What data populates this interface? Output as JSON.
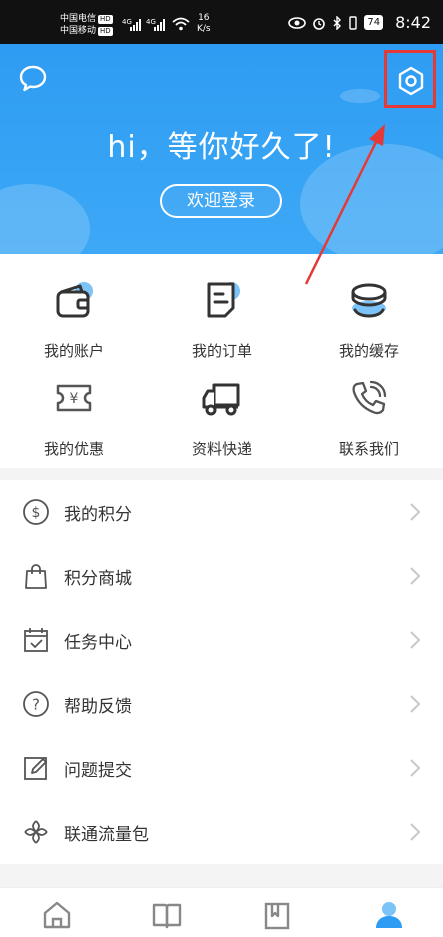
{
  "status_bar": {
    "carrier1": "中国电信",
    "carrier2": "中国移动",
    "hd": "HD",
    "net1": "4G",
    "net2": "4G",
    "speed_value": "16",
    "speed_unit": "K/s",
    "battery": "74",
    "time": "8:42"
  },
  "header": {
    "greeting": "hi，等你好久了!",
    "login_label": "欢迎登录",
    "accent_color": "#3aa4f5"
  },
  "grid": {
    "items": [
      {
        "label": "我的账户",
        "icon": "wallet-icon"
      },
      {
        "label": "我的订单",
        "icon": "order-icon"
      },
      {
        "label": "我的缓存",
        "icon": "cache-icon"
      },
      {
        "label": "我的优惠",
        "icon": "coupon-icon"
      },
      {
        "label": "资料快递",
        "icon": "delivery-truck-icon"
      },
      {
        "label": "联系我们",
        "icon": "phone-icon"
      }
    ]
  },
  "list": {
    "items": [
      {
        "label": "我的积分",
        "icon": "dollar-circle-icon"
      },
      {
        "label": "积分商城",
        "icon": "shopping-bag-icon"
      },
      {
        "label": "任务中心",
        "icon": "calendar-check-icon"
      },
      {
        "label": "帮助反馈",
        "icon": "question-circle-icon"
      },
      {
        "label": "问题提交",
        "icon": "edit-icon"
      },
      {
        "label": "联通流量包",
        "icon": "unicom-knot-icon"
      }
    ]
  },
  "bottom_nav": {
    "items": [
      {
        "icon": "home-icon"
      },
      {
        "icon": "book-icon"
      },
      {
        "icon": "library-icon"
      },
      {
        "icon": "profile-icon",
        "active": true
      }
    ]
  },
  "annotation": {
    "highlight_color": "#e53935"
  }
}
